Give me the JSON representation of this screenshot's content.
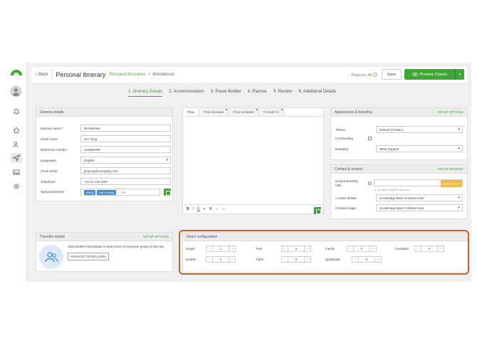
{
  "topbar": {
    "back": "Back",
    "title": "Personal itinerary",
    "crumb1": "Personal itineraries",
    "crumb_sep": ">",
    "crumb2": "Wonderlust",
    "regions_label": "Regions:",
    "regions_value": "All",
    "save": "Save",
    "preview": "Preview Classic"
  },
  "steps": [
    "1. Itinerary Details",
    "2. Accommodation",
    "3. Route Builder",
    "4. Planner",
    "5. Review",
    "6. Additional Details"
  ],
  "general": {
    "header": "General details",
    "fields": [
      {
        "label": "Itinerary name *",
        "value": "Wonderlust"
      },
      {
        "label": "Client name",
        "value": "Jim Yong"
      },
      {
        "label": "Reference number",
        "value": "123456789"
      },
      {
        "label": "Languages",
        "value": "English"
      },
      {
        "label": "Client email",
        "value": "jimyong@company.com"
      },
      {
        "label": "Telephone",
        "value": "+01 87 123 4567"
      }
    ],
    "interests_label": "Special interests",
    "tags": [
      "hiking",
      "trail running"
    ],
    "more": "+1"
  },
  "editor": {
    "tabs": [
      "Price",
      "Price includes",
      "Price excludes",
      "T's and C's"
    ],
    "toolbar": [
      "B",
      "I",
      "U",
      "≡",
      "≣",
      "⊘",
      "⊘"
    ]
  },
  "appearance": {
    "header": "Appearance & branding",
    "link": "SETUP OPTIONS",
    "theme_label": "Theme",
    "theme": "Default (Classic)",
    "cobranding_label": "Co-branding",
    "branding_label": "Branding",
    "branding": "Wetu Support"
  },
  "contact": {
    "header": "Contact & enquiry",
    "link": "SETUP OPTIONS",
    "booking_label": "Unique Booking URL",
    "checkout": "CHECKOUT",
    "booking_hint": "E.g. https://MyWebsite.com",
    "details_label": "Contact details",
    "details": "Knowledge Base Creation User",
    "image_label": "Contact image",
    "image": "Knowledge Base Creation User"
  },
  "traveller": {
    "header": "Traveller details",
    "link": "SETUP OPTIONS",
    "text": "Add traveller information to keep track of everyone going on this trip.",
    "button": "MANAGE TRAVELLERS"
  },
  "rooms": {
    "header": "Room configuration",
    "items": [
      {
        "label": "Single",
        "value": "1"
      },
      {
        "label": "Twin",
        "value": "0"
      },
      {
        "label": "Family",
        "value": "0"
      },
      {
        "label": "Campsite",
        "value": "0"
      },
      {
        "label": "Double",
        "value": "2"
      },
      {
        "label": "Triple",
        "value": "0"
      },
      {
        "label": "Quadruple",
        "value": "0"
      }
    ],
    "minus": "-",
    "plus": "+"
  },
  "colors": {
    "accent": "#3fa535",
    "highlight": "#c0622b",
    "tag": "#3d8fd5"
  }
}
